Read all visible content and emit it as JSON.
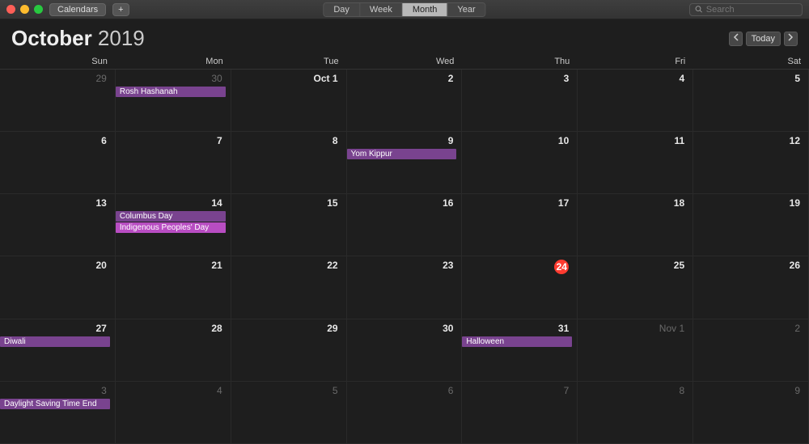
{
  "toolbar": {
    "calendars_label": "Calendars",
    "add_label": "+",
    "views": {
      "day": "Day",
      "week": "Week",
      "month": "Month",
      "year": "Year",
      "active": "Month"
    },
    "search_placeholder": "Search"
  },
  "header": {
    "month": "October",
    "year": "2019",
    "today_label": "Today"
  },
  "days_of_week": [
    "Sun",
    "Mon",
    "Tue",
    "Wed",
    "Thu",
    "Fri",
    "Sat"
  ],
  "colors": {
    "event_purple": "#79438f",
    "event_magenta": "#b84dc2",
    "today_red": "#ff3b30"
  },
  "cells": [
    {
      "label": "29",
      "outside": true,
      "events": []
    },
    {
      "label": "30",
      "outside": true,
      "events": [
        {
          "title": "Rosh Hashanah",
          "color": "event_purple"
        }
      ]
    },
    {
      "label": "Oct 1",
      "events": []
    },
    {
      "label": "2",
      "events": []
    },
    {
      "label": "3",
      "events": []
    },
    {
      "label": "4",
      "events": []
    },
    {
      "label": "5",
      "events": []
    },
    {
      "label": "6",
      "events": []
    },
    {
      "label": "7",
      "events": []
    },
    {
      "label": "8",
      "events": []
    },
    {
      "label": "9",
      "events": [
        {
          "title": "Yom Kippur",
          "color": "event_purple"
        }
      ]
    },
    {
      "label": "10",
      "events": []
    },
    {
      "label": "11",
      "events": []
    },
    {
      "label": "12",
      "events": []
    },
    {
      "label": "13",
      "events": []
    },
    {
      "label": "14",
      "events": [
        {
          "title": "Columbus Day",
          "color": "event_purple"
        },
        {
          "title": "Indigenous Peoples' Day",
          "color": "event_magenta"
        }
      ]
    },
    {
      "label": "15",
      "events": []
    },
    {
      "label": "16",
      "events": []
    },
    {
      "label": "17",
      "events": []
    },
    {
      "label": "18",
      "events": []
    },
    {
      "label": "19",
      "events": []
    },
    {
      "label": "20",
      "events": []
    },
    {
      "label": "21",
      "events": []
    },
    {
      "label": "22",
      "events": []
    },
    {
      "label": "23",
      "events": []
    },
    {
      "label": "24",
      "today": true,
      "events": []
    },
    {
      "label": "25",
      "events": []
    },
    {
      "label": "26",
      "events": []
    },
    {
      "label": "27",
      "events": [
        {
          "title": "Diwali",
          "color": "event_purple"
        }
      ]
    },
    {
      "label": "28",
      "events": []
    },
    {
      "label": "29",
      "events": []
    },
    {
      "label": "30",
      "events": []
    },
    {
      "label": "31",
      "events": [
        {
          "title": "Halloween",
          "color": "event_purple"
        }
      ]
    },
    {
      "label": "Nov 1",
      "outside": true,
      "events": []
    },
    {
      "label": "2",
      "outside": true,
      "events": []
    },
    {
      "label": "3",
      "outside": true,
      "events": [
        {
          "title": "Daylight Saving Time End",
          "color": "event_purple"
        }
      ]
    },
    {
      "label": "4",
      "outside": true,
      "events": []
    },
    {
      "label": "5",
      "outside": true,
      "events": []
    },
    {
      "label": "6",
      "outside": true,
      "events": []
    },
    {
      "label": "7",
      "outside": true,
      "events": []
    },
    {
      "label": "8",
      "outside": true,
      "events": []
    },
    {
      "label": "9",
      "outside": true,
      "events": []
    }
  ]
}
